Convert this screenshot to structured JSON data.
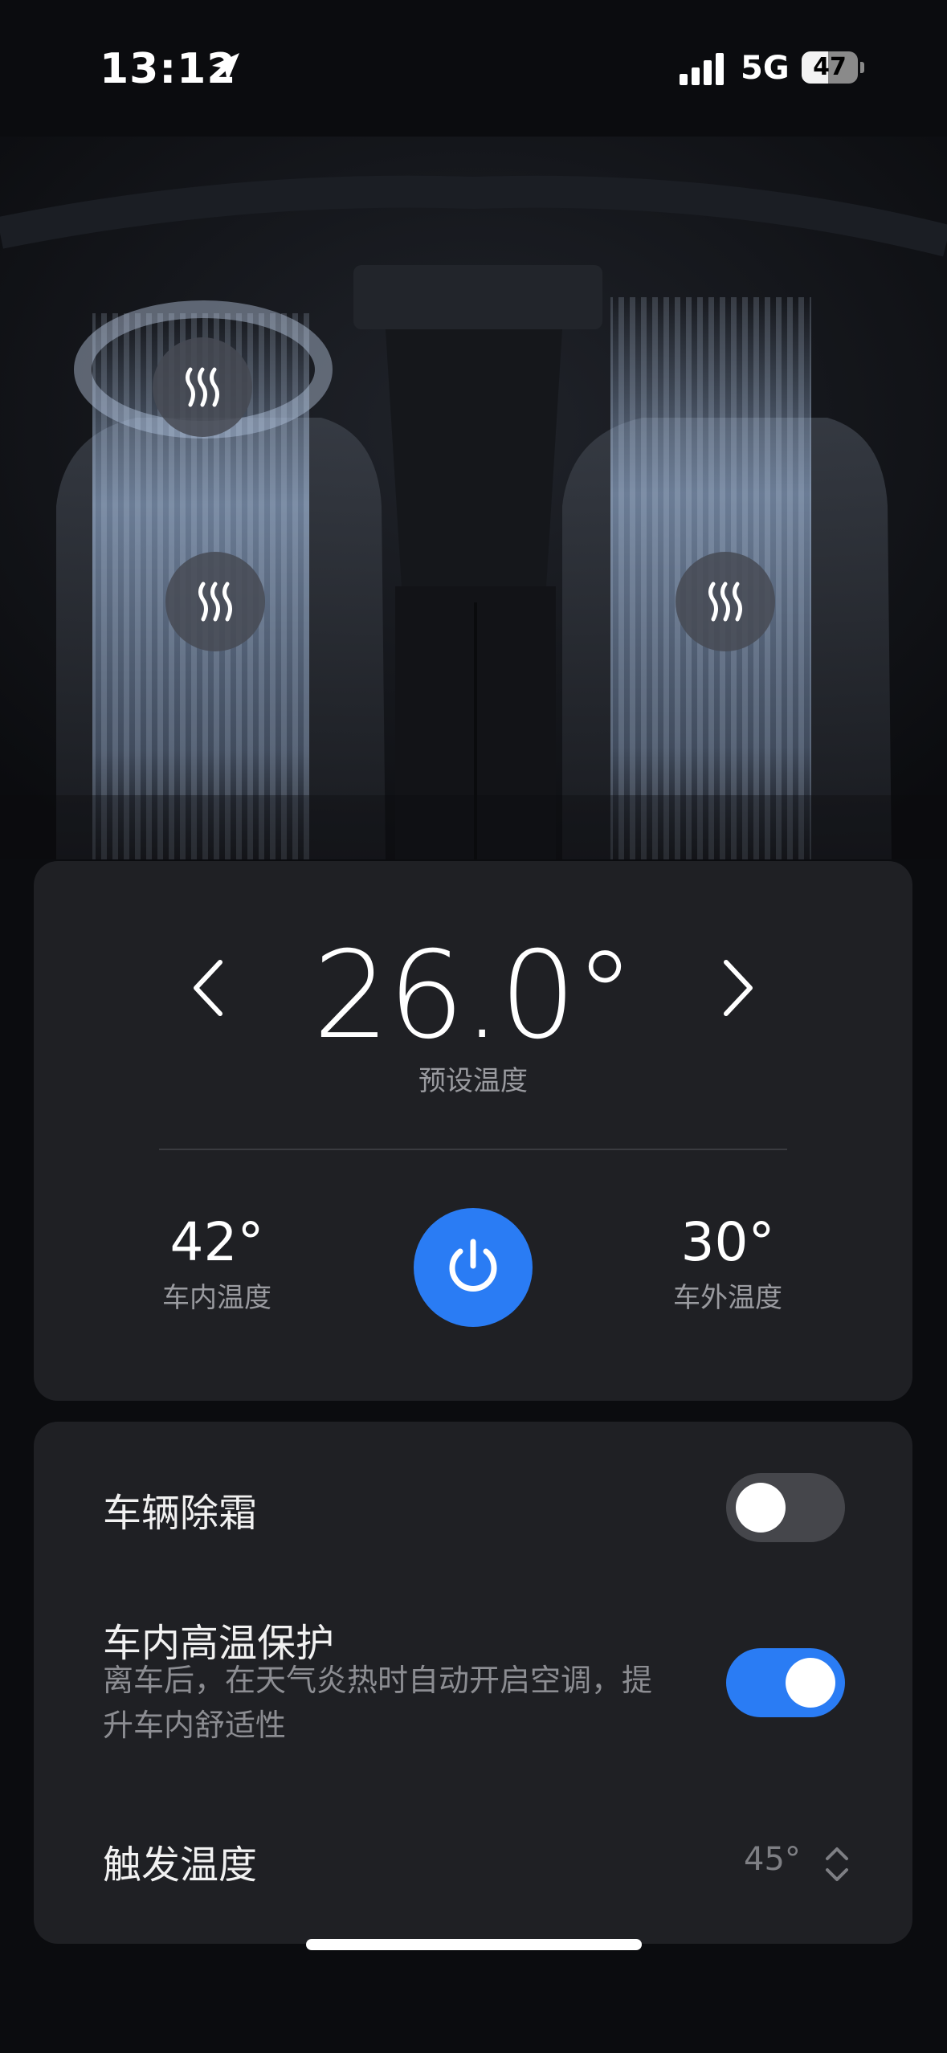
{
  "status_bar": {
    "time": "13:12",
    "network": "5G",
    "battery": "47",
    "battery_level": 0.47
  },
  "climate": {
    "setpoint": "26.0°",
    "setpoint_label": "预设温度",
    "inside_temp": "42°",
    "inside_label": "车内温度",
    "outside_temp": "30°",
    "outside_label": "车外温度",
    "power_on": true
  },
  "settings": {
    "defrost": {
      "label": "车辆除霜",
      "enabled": false
    },
    "heat_protection": {
      "label": "车内高温保护",
      "description": "离车后，在天气炎热时自动开启空调，提升车内舒适性",
      "enabled": true
    },
    "trigger_temp": {
      "label": "触发温度",
      "value": "45°"
    }
  },
  "colors": {
    "accent": "#2a7cf4",
    "card": "#1f2024",
    "background": "#0b0c0f"
  },
  "icons": [
    "location-arrow-icon",
    "signal-icon",
    "battery-icon",
    "back-arrow-icon",
    "heat-icon",
    "chevron-left-icon",
    "chevron-right-icon",
    "power-icon",
    "up-down-chevron-icon"
  ]
}
